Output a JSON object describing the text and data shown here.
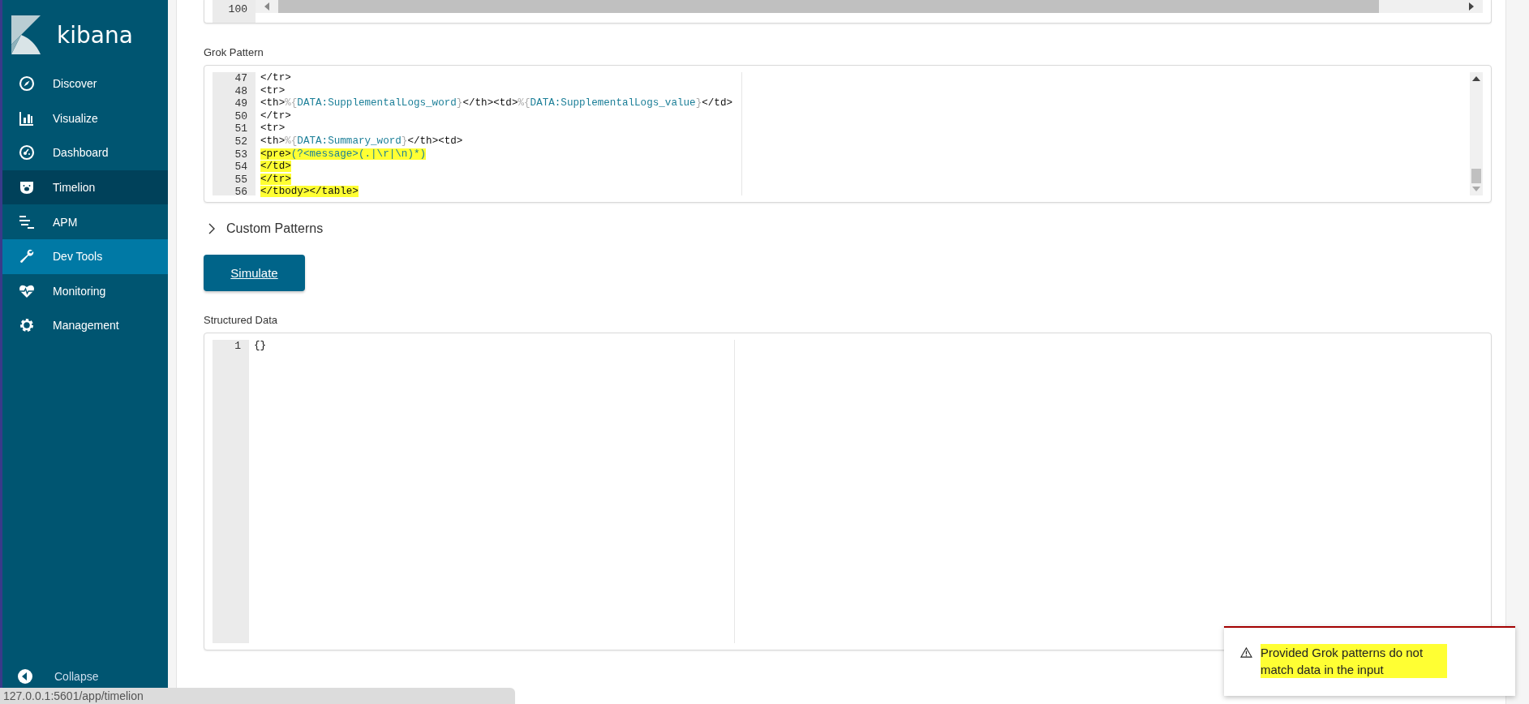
{
  "sidebar": {
    "brand": "kibana",
    "items": [
      {
        "label": "Discover",
        "selected": false,
        "hovered": false
      },
      {
        "label": "Visualize",
        "selected": false,
        "hovered": false
      },
      {
        "label": "Dashboard",
        "selected": false,
        "hovered": false
      },
      {
        "label": "Timelion",
        "selected": false,
        "hovered": true
      },
      {
        "label": "APM",
        "selected": false,
        "hovered": false
      },
      {
        "label": "Dev Tools",
        "selected": true,
        "hovered": false
      },
      {
        "label": "Monitoring",
        "selected": false,
        "hovered": false
      },
      {
        "label": "Management",
        "selected": false,
        "hovered": false
      }
    ],
    "collapse": "Collapse"
  },
  "top_editor": {
    "line_numbers": [
      "100"
    ]
  },
  "grok_pattern": {
    "label": "Grok Pattern",
    "lines": [
      {
        "number": "47",
        "highlighted": false,
        "segments": [
          {
            "kind": "plain",
            "text": "</tr>"
          }
        ]
      },
      {
        "number": "48",
        "highlighted": false,
        "segments": [
          {
            "kind": "plain",
            "text": "<tr>"
          }
        ]
      },
      {
        "number": "49",
        "highlighted": false,
        "segments": [
          {
            "kind": "plain",
            "text": "<th>"
          },
          {
            "kind": "brace",
            "text": "%{"
          },
          {
            "kind": "name",
            "text": "DATA:SupplementalLogs_word"
          },
          {
            "kind": "brace",
            "text": "}"
          },
          {
            "kind": "plain",
            "text": "</th><td>"
          },
          {
            "kind": "brace",
            "text": "%{"
          },
          {
            "kind": "name",
            "text": "DATA:SupplementalLogs_value"
          },
          {
            "kind": "brace",
            "text": "}"
          },
          {
            "kind": "plain",
            "text": "</td>"
          }
        ]
      },
      {
        "number": "50",
        "highlighted": false,
        "segments": [
          {
            "kind": "plain",
            "text": "</tr>"
          }
        ]
      },
      {
        "number": "51",
        "highlighted": false,
        "segments": [
          {
            "kind": "plain",
            "text": "<tr>"
          }
        ]
      },
      {
        "number": "52",
        "highlighted": false,
        "segments": [
          {
            "kind": "plain",
            "text": "<th>"
          },
          {
            "kind": "brace",
            "text": "%{"
          },
          {
            "kind": "name",
            "text": "DATA:Summary_word"
          },
          {
            "kind": "brace",
            "text": "}"
          },
          {
            "kind": "plain",
            "text": "</th><td>"
          }
        ]
      },
      {
        "number": "53",
        "highlighted": true,
        "segments": [
          {
            "kind": "plain",
            "text": "<pre>"
          },
          {
            "kind": "name",
            "text": "(?<message>(.|\\r|\\n)*)"
          }
        ]
      },
      {
        "number": "54",
        "highlighted": true,
        "segments": [
          {
            "kind": "plain",
            "text": "</td>"
          }
        ]
      },
      {
        "number": "55",
        "highlighted": true,
        "segments": [
          {
            "kind": "plain",
            "text": "</tr>"
          }
        ]
      },
      {
        "number": "56",
        "highlighted": true,
        "segments": [
          {
            "kind": "plain",
            "text": "</tbody></table>"
          }
        ]
      }
    ]
  },
  "custom_patterns": {
    "label": "Custom Patterns",
    "expanded": false
  },
  "simulate_button": "Simulate",
  "structured_data": {
    "label": "Structured Data",
    "lines": [
      {
        "number": "1",
        "text": "{}"
      }
    ]
  },
  "toast": {
    "message": "Provided Grok patterns do not match data in the input",
    "highlighted": true
  },
  "status_bar": {
    "url": "127.0.0.1:5601/app/timelion"
  }
}
